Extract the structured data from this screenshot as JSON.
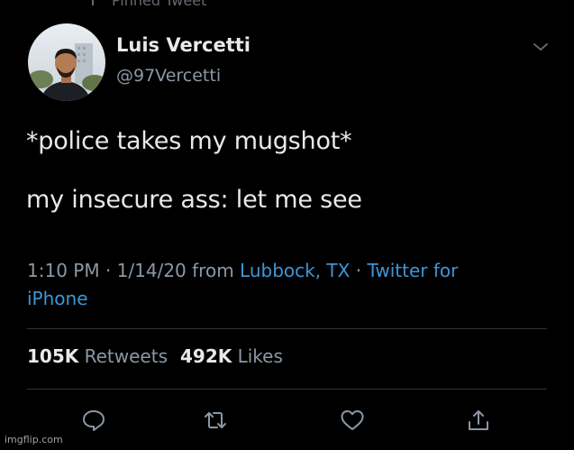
{
  "pinned": {
    "label": "Pinned Tweet",
    "icon": "pin-icon"
  },
  "author": {
    "name": "Luis Vercetti",
    "handle": "@97Vercetti",
    "avatar_icon": "avatar"
  },
  "tweet": {
    "line1": "*police takes my mugshot*",
    "line2": "my insecure ass: let me see"
  },
  "meta": {
    "time": "1:10 PM",
    "separator1": " · ",
    "date": "1/14/20",
    "from_word": " from ",
    "location": "Lubbock, TX",
    "separator2": " · ",
    "client_part1": "Twitter for",
    "client_part2": "iPhone"
  },
  "stats": {
    "retweets_count": "105K",
    "retweets_label": "Retweets",
    "likes_count": "492K",
    "likes_label": "Likes"
  },
  "actions": {
    "reply_icon": "reply-icon",
    "retweet_icon": "retweet-icon",
    "like_icon": "heart-icon",
    "share_icon": "share-icon"
  },
  "watermark": "imgflip.com",
  "colors": {
    "background": "#000000",
    "primary_text": "#e7e9ea",
    "secondary_text": "#8b98a5",
    "link": "#3d96d6",
    "divider": "#2f3336"
  }
}
